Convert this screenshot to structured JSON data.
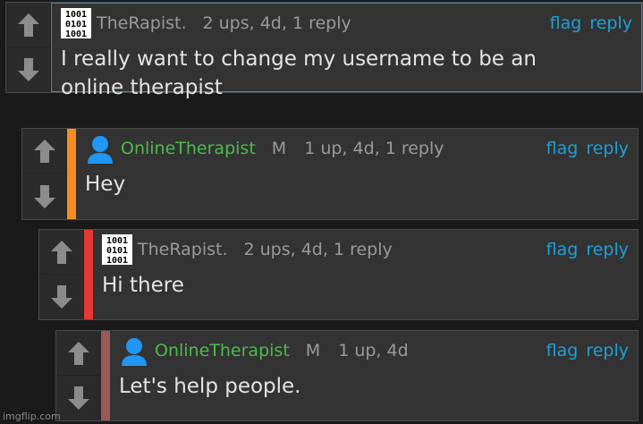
{
  "labels": {
    "flag": "flag",
    "reply": "reply"
  },
  "comments": [
    {
      "user": "TheRapist.",
      "mod": "",
      "stats": "2 ups, 4d, 1 reply",
      "lines": [
        "I really want to change my username to be an",
        "online therapist"
      ]
    },
    {
      "user": "OnlineTherapist",
      "mod": "M",
      "stats": "1 up, 4d, 1 reply",
      "lines": [
        "Hey"
      ]
    },
    {
      "user": "TheRapist.",
      "mod": "",
      "stats": "2 ups, 4d, 1 reply",
      "lines": [
        "Hi there"
      ]
    },
    {
      "user": "OnlineTherapist",
      "mod": "M",
      "stats": "1 up, 4d",
      "lines": [
        "Let's help people."
      ]
    }
  ],
  "depth_colors": [
    "#f58c1f",
    "#e53935",
    "#9a5a5a"
  ],
  "watermark": "imgflip.com"
}
